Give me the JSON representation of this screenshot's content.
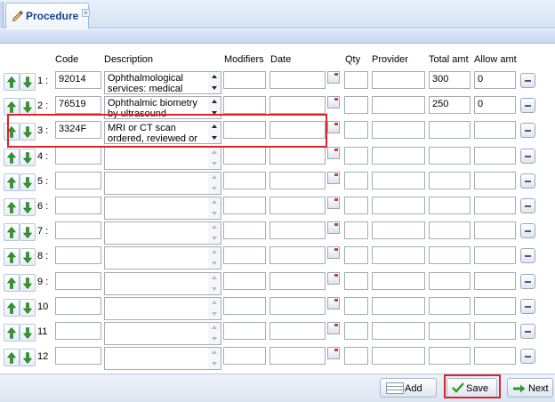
{
  "tab": {
    "label": "Procedure",
    "close_glyph": "×",
    "icon": "pencil-icon"
  },
  "columns": {
    "code": "Code",
    "description": "Description",
    "modifiers": "Modifiers",
    "date": "Date",
    "qty": "Qty",
    "provider": "Provider",
    "total_amt": "Total amt",
    "allow_amt": "Allow amt"
  },
  "rows": [
    {
      "num": "1 :",
      "code": "92014",
      "description": "Ophthalmological services: medical",
      "total_amt": "300",
      "allow_amt": "0"
    },
    {
      "num": "2 :",
      "code": "76519",
      "description": "Ophthalmic biometry by ultrasound",
      "total_amt": "250",
      "allow_amt": "0"
    },
    {
      "num": "3 :",
      "code": "3324F",
      "description": "MRI or CT scan ordered, reviewed or",
      "total_amt": "",
      "allow_amt": ""
    },
    {
      "num": "4 :",
      "code": "",
      "description": "",
      "total_amt": "",
      "allow_amt": ""
    },
    {
      "num": "5 :",
      "code": "",
      "description": "",
      "total_amt": "",
      "allow_amt": ""
    },
    {
      "num": "6 :",
      "code": "",
      "description": "",
      "total_amt": "",
      "allow_amt": ""
    },
    {
      "num": "7 :",
      "code": "",
      "description": "",
      "total_amt": "",
      "allow_amt": ""
    },
    {
      "num": "8 :",
      "code": "",
      "description": "",
      "total_amt": "",
      "allow_amt": ""
    },
    {
      "num": "9 :",
      "code": "",
      "description": "",
      "total_amt": "",
      "allow_amt": ""
    },
    {
      "num": "10",
      "code": "",
      "description": "",
      "total_amt": "",
      "allow_amt": ""
    },
    {
      "num": "11",
      "code": "",
      "description": "",
      "total_amt": "",
      "allow_amt": ""
    },
    {
      "num": "12",
      "code": "",
      "description": "",
      "total_amt": "",
      "allow_amt": ""
    }
  ],
  "footer": {
    "add": "Add",
    "save": "Save",
    "next": "Next"
  },
  "colors": {
    "highlight": "#d9252b",
    "arrow_green": "#2f9a2a",
    "tab_text": "#15428b"
  }
}
